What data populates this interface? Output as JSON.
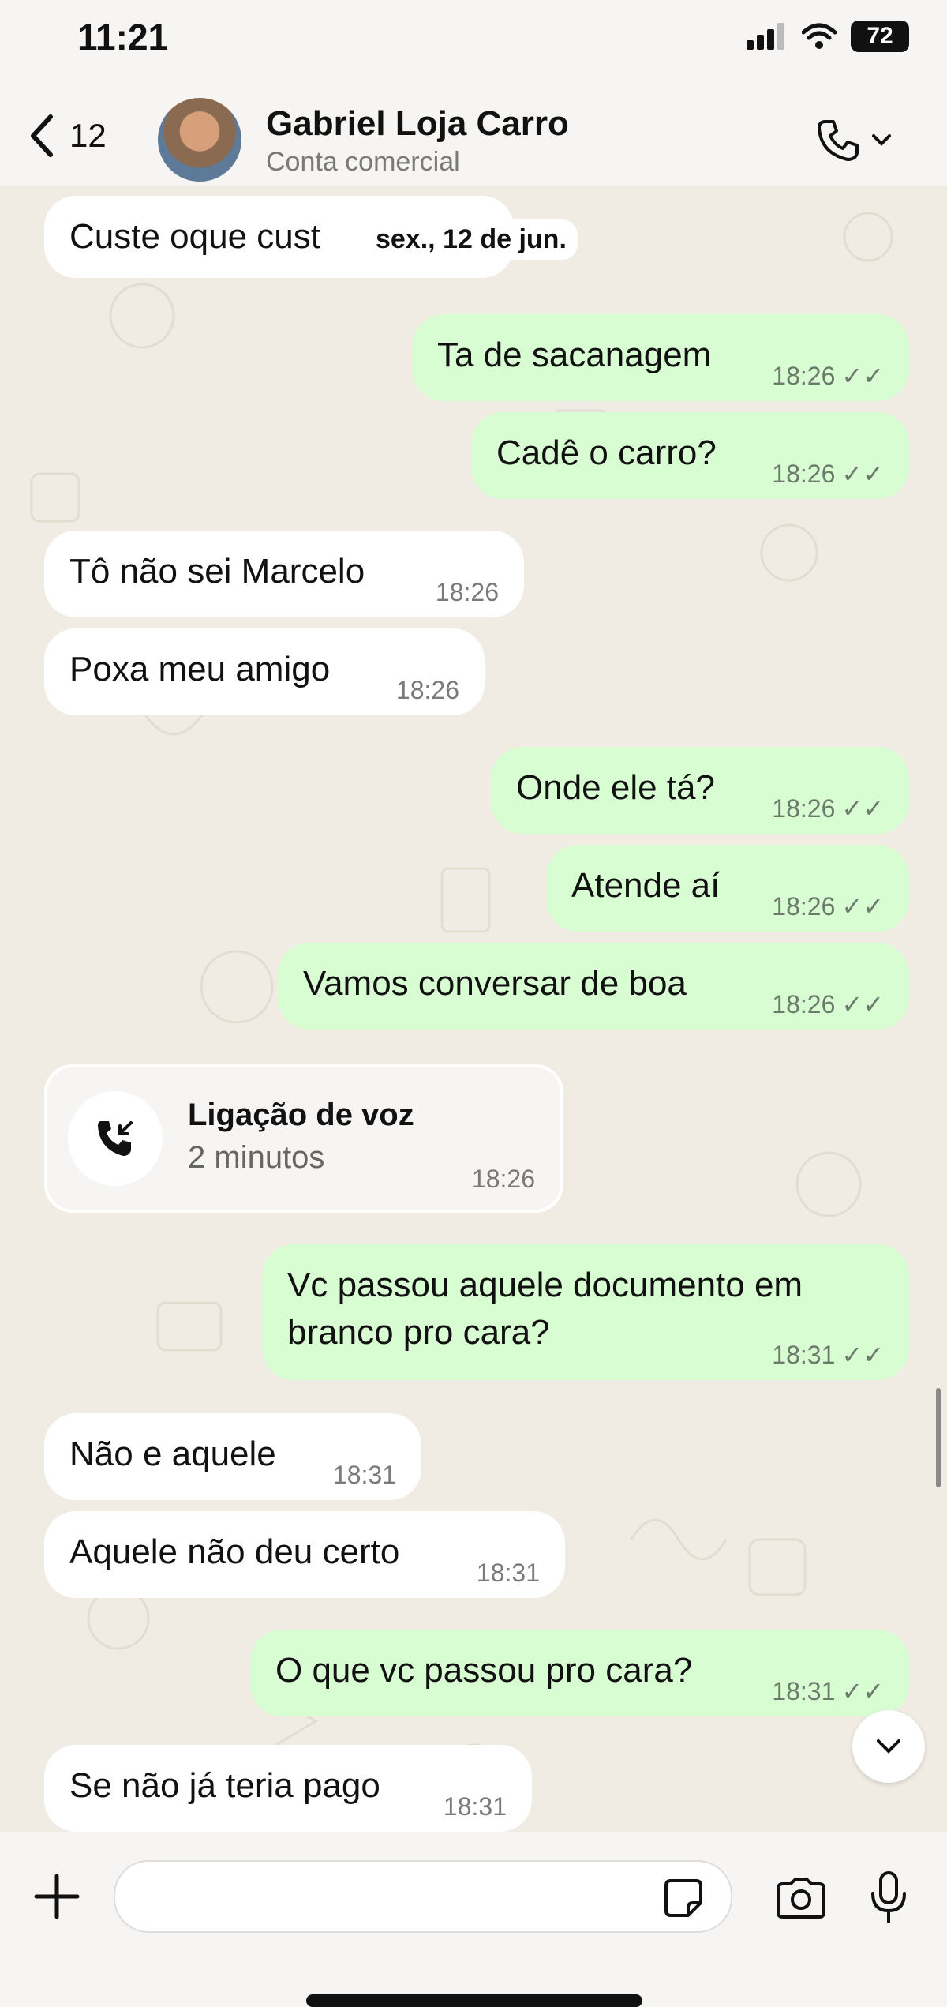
{
  "status_bar": {
    "time": "11:21",
    "battery": "72"
  },
  "header": {
    "back_count": "12",
    "contact_name": "Gabriel Loja Carro",
    "contact_subtitle": "Conta comercial"
  },
  "date_chip": "sex., 12 de jun.",
  "messages": [
    {
      "dir": "in",
      "text": "Custe oque cust",
      "time": ""
    },
    {
      "dir": "out",
      "text": "Ta de sacanagem",
      "time": "18:26"
    },
    {
      "dir": "out",
      "text": "Cadê o carro?",
      "time": "18:26"
    },
    {
      "dir": "in",
      "text": "Tô não sei Marcelo",
      "time": "18:26"
    },
    {
      "dir": "in",
      "text": "Poxa meu amigo",
      "time": "18:26"
    },
    {
      "dir": "out",
      "text": "Onde ele tá?",
      "time": "18:26"
    },
    {
      "dir": "out",
      "text": "Atende aí",
      "time": "18:26"
    },
    {
      "dir": "out",
      "text": "Vamos conversar de boa",
      "time": "18:26"
    },
    {
      "dir": "out",
      "text": "Vc passou aquele documento em branco pro cara?",
      "time": "18:31"
    },
    {
      "dir": "in",
      "text": "Não e aquele",
      "time": "18:31"
    },
    {
      "dir": "in",
      "text": "Aquele não deu certo",
      "time": "18:31"
    },
    {
      "dir": "out",
      "text": "O que vc passou pro cara?",
      "time": "18:31"
    },
    {
      "dir": "in",
      "text": "Se não já teria pago",
      "time": "18:31"
    }
  ],
  "call": {
    "title": "Ligação de voz",
    "duration": "2 minutos",
    "time": "18:26"
  },
  "colors": {
    "outgoing": "#d9fdd3",
    "incoming": "#ffffff",
    "background": "#f0ebe3"
  },
  "icons": {
    "back": "chevron-left-icon",
    "call": "phone-icon",
    "incoming_call": "incoming-call-icon",
    "sticker": "sticker-icon",
    "camera": "camera-icon",
    "mic": "mic-icon",
    "plus": "plus-icon",
    "scroll_down": "chevron-down-icon"
  }
}
